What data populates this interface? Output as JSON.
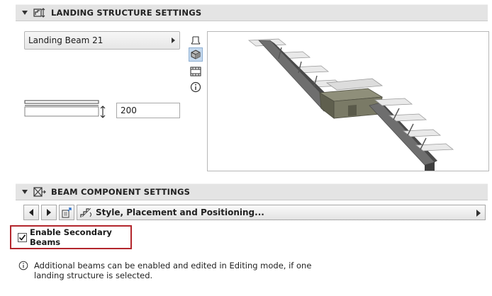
{
  "landing_section": {
    "title": "LANDING STRUCTURE SETTINGS"
  },
  "landing_type": {
    "value": "Landing Beam 21"
  },
  "view_buttons": [
    "2d-plan-icon",
    "3d-view-icon",
    "section-view-icon",
    "info-icon"
  ],
  "height_field": {
    "value": "200"
  },
  "beam_section": {
    "title": "BEAM COMPONENT SETTINGS"
  },
  "page_selector": {
    "label": "Style, Placement and Positioning..."
  },
  "secondary_beams": {
    "label": "Enable Secondary Beams",
    "checked": true
  },
  "info_note": {
    "text": "Additional beams can be enabled and edited in Editing mode, if one landing structure is selected."
  },
  "colors": {
    "header_bg": "#e4e4e4",
    "highlight_border": "#b3262c",
    "selected_view_bg": "#c5d9ee"
  }
}
